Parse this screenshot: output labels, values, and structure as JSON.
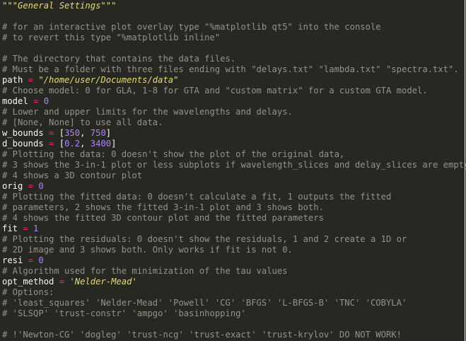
{
  "editor": {
    "lines": [
      {
        "type": "doc",
        "text": "\"\"\"General Settings\"\"\""
      },
      {
        "type": "blank"
      },
      {
        "type": "comment",
        "text": "# for an interactive plot overlay type \"%matplotlib qt5\" into the console"
      },
      {
        "type": "comment",
        "text": "# to revert this type \"%matplotlib inline\""
      },
      {
        "type": "blank"
      },
      {
        "type": "comment",
        "text": "# The directory that contains the data files."
      },
      {
        "type": "comment",
        "text": "# Must be a folder with three files ending with \"delays.txt\" \"lambda.txt\" \"spectra.txt\"."
      },
      {
        "type": "assign",
        "var": "path",
        "value": "\"/home/user/Documents/data\"",
        "vtype": "str"
      },
      {
        "type": "comment",
        "text": "# Choose model: 0 for GLA, 1-8 for GTA and \"custom matrix\" for a custom GTA model."
      },
      {
        "type": "assign",
        "var": "model",
        "value": "0",
        "vtype": "num"
      },
      {
        "type": "comment",
        "text": "# Lower and upper limits for the wavelengths and delays."
      },
      {
        "type": "comment",
        "text": "# [None, None] to use all data."
      },
      {
        "type": "list",
        "var": "w_bounds",
        "a": "350",
        "b": "750"
      },
      {
        "type": "list",
        "var": "d_bounds",
        "a": "0.2",
        "b": "3400"
      },
      {
        "type": "comment",
        "text": "# Plotting the data: 0 doesn't show the plot of the original data,"
      },
      {
        "type": "comment",
        "text": "# 3 shows the 3-in-1 plot or less subplots if wavelength_slices and delay_slices are empty."
      },
      {
        "type": "comment",
        "text": "# 4 shows a 3D contour plot"
      },
      {
        "type": "assign",
        "var": "orig",
        "value": "0",
        "vtype": "num"
      },
      {
        "type": "comment",
        "text": "# Plotting the fitted data: 0 doesn't calculate a fit, 1 outputs the fitted"
      },
      {
        "type": "comment",
        "text": "# parameters, 2 shows the fitted 3-in-1 plot and 3 shows both."
      },
      {
        "type": "comment",
        "text": "# 4 shows the fitted 3D contour plot and the fitted parameters"
      },
      {
        "type": "assign",
        "var": "fit",
        "value": "1",
        "vtype": "num"
      },
      {
        "type": "comment",
        "text": "# Plotting the residuals: 0 doesn't show the residuals, 1 and 2 create a 1D or"
      },
      {
        "type": "comment",
        "text": "# 2D image and 3 shows both. Only works if fit is not 0."
      },
      {
        "type": "assign",
        "var": "resi",
        "value": "0",
        "vtype": "num"
      },
      {
        "type": "comment",
        "text": "# Algorithm used for the minimization of the tau values"
      },
      {
        "type": "assign",
        "var": "opt_method",
        "value": "'Nelder-Mead'",
        "vtype": "str"
      },
      {
        "type": "comment",
        "text": "# Options:"
      },
      {
        "type": "comment",
        "text": "# 'least_squares' 'Nelder-Mead' 'Powell' 'CG' 'BFGS' 'L-BFGS-B' 'TNC' 'COBYLA'"
      },
      {
        "type": "comment",
        "text": "# 'SLSQP' 'trust-constr' 'ampgo' 'basinhopping'"
      },
      {
        "type": "blank"
      },
      {
        "type": "comment",
        "text": "# !'Newton-CG' 'dogleg' 'trust-ncg' 'trust-exact' 'trust-krylov' DO NOT WORK!"
      }
    ],
    "colors": {
      "background": "#272822",
      "comment": "#959288",
      "string": "#e6db74",
      "number": "#ae81ff",
      "operator": "#f92672",
      "text": "#f8f8f2"
    }
  }
}
